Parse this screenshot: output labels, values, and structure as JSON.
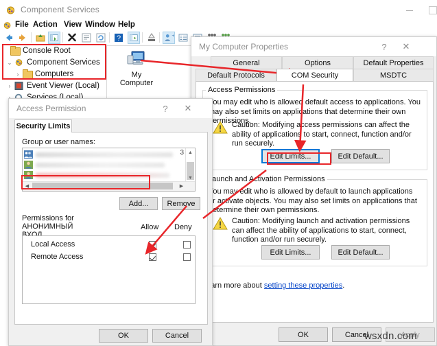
{
  "mmc": {
    "title": "Component Services",
    "icon": "component-services-icon",
    "window_controls": {
      "minimize": "–",
      "maximize": "□"
    },
    "menu": [
      {
        "label": "File"
      },
      {
        "label": "Action"
      },
      {
        "label": "View"
      },
      {
        "label": "Window"
      },
      {
        "label": "Help"
      }
    ],
    "toolbar": [
      {
        "name": "back-icon"
      },
      {
        "name": "forward-icon"
      },
      {
        "name": "up-folder-icon"
      },
      {
        "name": "show-hide-tree-icon"
      },
      {
        "name": "delete-icon"
      },
      {
        "name": "properties-icon"
      },
      {
        "name": "refresh-icon"
      },
      {
        "name": "help-icon"
      },
      {
        "name": "console-icon"
      },
      {
        "name": "export-icon"
      },
      {
        "name": "new-object-icon"
      },
      {
        "name": "list-details-icon"
      },
      {
        "name": "list-icon"
      },
      {
        "name": "grid-icon"
      },
      {
        "name": "table-icon"
      }
    ],
    "tree": [
      {
        "label": "Console Root",
        "chevron": "",
        "icon": "folder-icon",
        "indent": 0
      },
      {
        "label": "Component Services",
        "chevron": "⌄",
        "icon": "component-services-icon",
        "indent": 1
      },
      {
        "label": "Computers",
        "chevron": "›",
        "icon": "folder-icon",
        "indent": 2
      },
      {
        "label": "Event Viewer (Local)",
        "chevron": "›",
        "icon": "event-viewer-icon",
        "indent": 1
      },
      {
        "label": "Services (Local)",
        "chevron": "›",
        "icon": "services-icon",
        "indent": 1
      }
    ],
    "list_item": {
      "label_line1": "My",
      "label_line2": "Computer",
      "icon": "my-computer-icon"
    }
  },
  "my_computer_properties": {
    "title": "My Computer Properties",
    "help_glyph": "?",
    "close_glyph": "✕",
    "tabs_row1": [
      {
        "label": "General",
        "selected": false
      },
      {
        "label": "Options",
        "selected": false
      },
      {
        "label": "Default Properties",
        "selected": false
      }
    ],
    "tabs_row2": [
      {
        "label": "Default Protocols",
        "selected": false
      },
      {
        "label": "COM Security",
        "selected": true
      },
      {
        "label": "MSDTC",
        "selected": false
      }
    ],
    "access_permissions": {
      "legend": "Access Permissions",
      "description": "You may edit who is allowed default access to applications. You may also set limits on applications that determine their own permissions.",
      "caution": "Caution: Modifying access permissions can affect the ability of applications to start, connect, function and/or run securely.",
      "edit_limits": "Edit Limits...",
      "edit_default": "Edit Default..."
    },
    "launch_permissions": {
      "legend": "Launch and Activation Permissions",
      "description": "You may edit who is allowed by default to launch applications or activate objects. You may also set limits on applications that determine their own permissions.",
      "caution": "Caution: Modifying launch and activation permissions can affect the ability of applications to start, connect, function and/or run securely.",
      "edit_limits": "Edit Limits...",
      "edit_default": "Edit Default..."
    },
    "footer_text_prefix": "Learn more about ",
    "footer_link": "setting these properties",
    "footer_text_suffix": ".",
    "buttons": {
      "ok": "OK",
      "cancel": "Cancel",
      "apply": "Apply"
    }
  },
  "access_permission": {
    "title": "Access Permission",
    "help_glyph": "?",
    "close_glyph": "✕",
    "tabs": [
      {
        "label": "Security Limits",
        "selected": true
      }
    ],
    "group_label": "Group or user names:",
    "group_entries": [
      {
        "icon": "group-icon",
        "redacted": true
      },
      {
        "icon": "user-icon",
        "redacted": true
      },
      {
        "icon": "user-icon",
        "redacted": true
      },
      {
        "icon": "user-icon",
        "redacted": true,
        "highlighted": true
      }
    ],
    "list_overflow_text": "3",
    "buttons": {
      "add": "Add...",
      "remove": "Remove"
    },
    "permissions_label_line1": "Permissions for АНОНИМНЫЙ",
    "permissions_label_line2": "ВХОД",
    "columns": [
      "Allow",
      "Deny"
    ],
    "rows": [
      {
        "name": "Local Access",
        "allow": true,
        "deny": false
      },
      {
        "name": "Remote Access",
        "allow": true,
        "deny": false
      }
    ],
    "footer_buttons": {
      "ok": "OK",
      "cancel": "Cancel"
    }
  },
  "annotations": {
    "accent_color": "#e8262a",
    "focus_color": "#0078d7",
    "boxes": [
      {
        "name": "tree-highlight-box"
      },
      {
        "name": "list-entry-highlight-box"
      },
      {
        "name": "edit-limits-highlight-box"
      }
    ],
    "arrows": [
      {
        "name": "arrow-to-com-security"
      },
      {
        "name": "arrow-to-edit-limits"
      },
      {
        "name": "arrow-to-access-permission-dialog"
      },
      {
        "name": "arrow-to-remote-access-checkbox"
      }
    ]
  },
  "watermark": {
    "text": "wsxdn.com"
  }
}
